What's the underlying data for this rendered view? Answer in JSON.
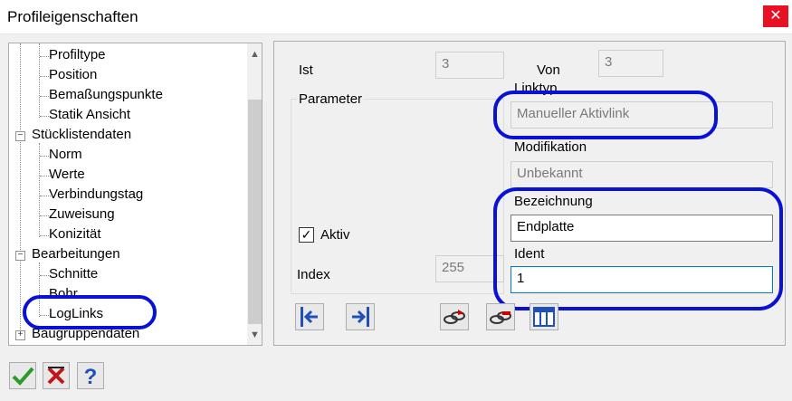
{
  "window": {
    "title": "Profileigenschaften",
    "close_glyph": "✕"
  },
  "tree": {
    "items": [
      {
        "label": "Profiltype"
      },
      {
        "label": "Position"
      },
      {
        "label": "Bemaßungspunkte"
      },
      {
        "label": "Statik Ansicht"
      },
      {
        "label": "Stücklistendaten",
        "expander": "−"
      },
      {
        "label": "Norm"
      },
      {
        "label": "Werte"
      },
      {
        "label": "Verbindungstag"
      },
      {
        "label": "Zuweisung"
      },
      {
        "label": "Konizität"
      },
      {
        "label": "Bearbeitungen",
        "expander": "−"
      },
      {
        "label": "Schnitte"
      },
      {
        "label": "Bohr."
      },
      {
        "label": "LogLinks"
      },
      {
        "label": "Baugruppendaten",
        "expander": "+"
      }
    ],
    "scroll_up": "▲",
    "scroll_down": "▼"
  },
  "panel": {
    "ist_label": "Ist",
    "ist_value": "3",
    "von_label": "Von",
    "von_value": "3",
    "parameter_label": "Parameter",
    "linktyp_label": "Linktyp",
    "linktyp_value": "Manueller Aktivlink",
    "modifikation_label": "Modifikation",
    "modifikation_value": "Unbekannt",
    "bezeichnung_label": "Bezeichnung",
    "bezeichnung_value": "Endplatte",
    "ident_label": "Ident",
    "ident_value": "1",
    "aktiv_label": "Aktiv",
    "aktiv_checked": "✓",
    "index_label": "Index",
    "index_value": "255"
  },
  "colors": {
    "highlight": "#0a11d6",
    "close_bg": "#e81123"
  }
}
